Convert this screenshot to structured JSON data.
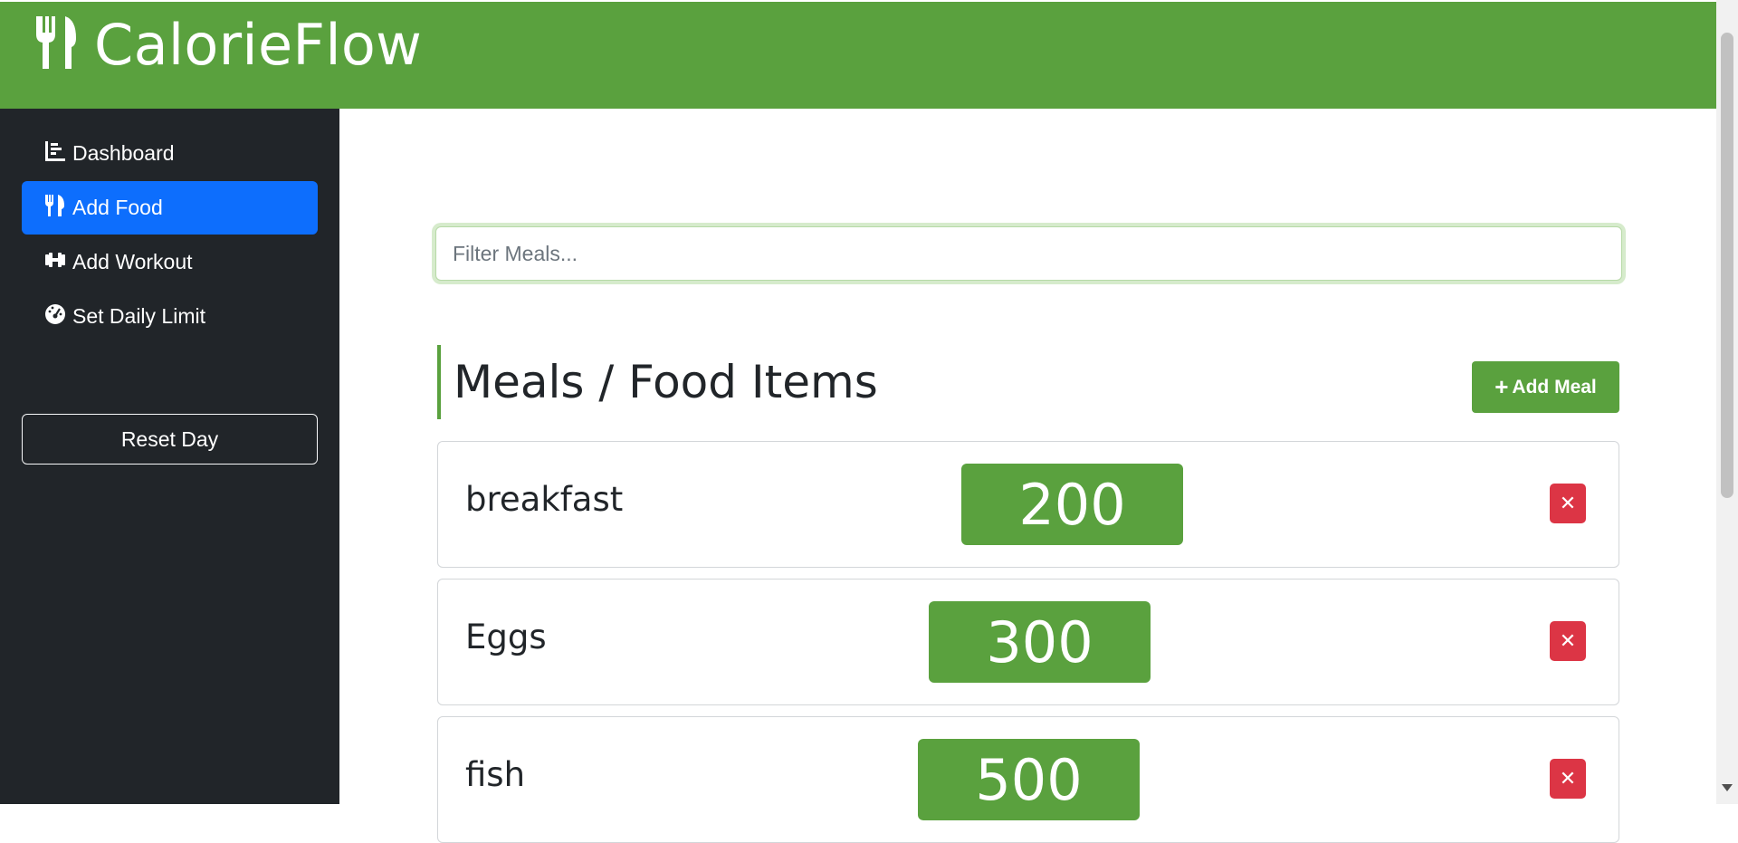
{
  "app": {
    "title": "CalorieFlow",
    "logo_icon": "utensils-icon"
  },
  "sidebar": {
    "items": [
      {
        "label": "Dashboard",
        "icon": "chart-bar-icon",
        "active": false
      },
      {
        "label": "Add Food",
        "icon": "utensils-icon",
        "active": true
      },
      {
        "label": "Add Workout",
        "icon": "dumbbell-icon",
        "active": false
      },
      {
        "label": "Set Daily Limit",
        "icon": "gauge-icon",
        "active": false
      }
    ],
    "reset_label": "Reset Day"
  },
  "main": {
    "filter_placeholder": "Filter Meals...",
    "section_title": "Meals / Food Items",
    "add_meal_label": "Add Meal",
    "meals": [
      {
        "name": "breakfast",
        "calories": "200"
      },
      {
        "name": "Eggs",
        "calories": "300"
      },
      {
        "name": "fish",
        "calories": "500"
      }
    ],
    "delete_glyph": "✕"
  },
  "colors": {
    "brand_green": "#5aa13e",
    "sidebar_bg": "#212529",
    "active_blue": "#0d6efd",
    "danger_red": "#dc3545"
  }
}
